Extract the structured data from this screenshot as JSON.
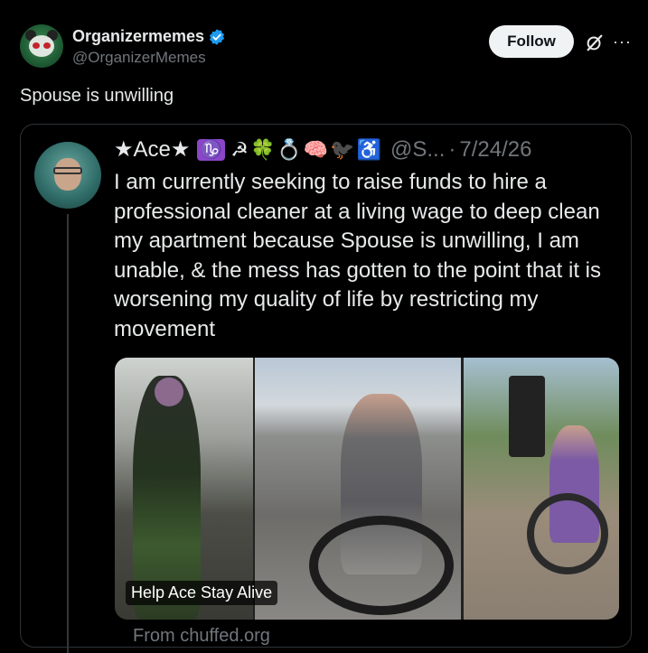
{
  "post": {
    "author_name": "Organizermemes",
    "author_handle": "@OrganizerMemes",
    "verified": true,
    "follow_label": "Follow",
    "more_label": "···",
    "text": "Spouse is unwilling"
  },
  "quoted": {
    "name": "★Ace★",
    "emojis": "☭🍀💍🧠🐦‍⬛♿",
    "capricorn": "♑",
    "handle": "@S...",
    "separator": "·",
    "date": "7/24/26",
    "text": "I am currently seeking to raise funds to hire a professional cleaner at a living wage to deep clean my apartment because Spouse is unwilling, I am unable, & the mess has gotten to the point that it is worsening my quality of life by restricting my movement",
    "card": {
      "title": "Help Ace Stay Alive",
      "source": "From chuffed.org"
    }
  },
  "colors": {
    "background": "#000000",
    "text": "#e7e9ea",
    "secondary": "#71767b",
    "verified": "#1d9bf0"
  }
}
